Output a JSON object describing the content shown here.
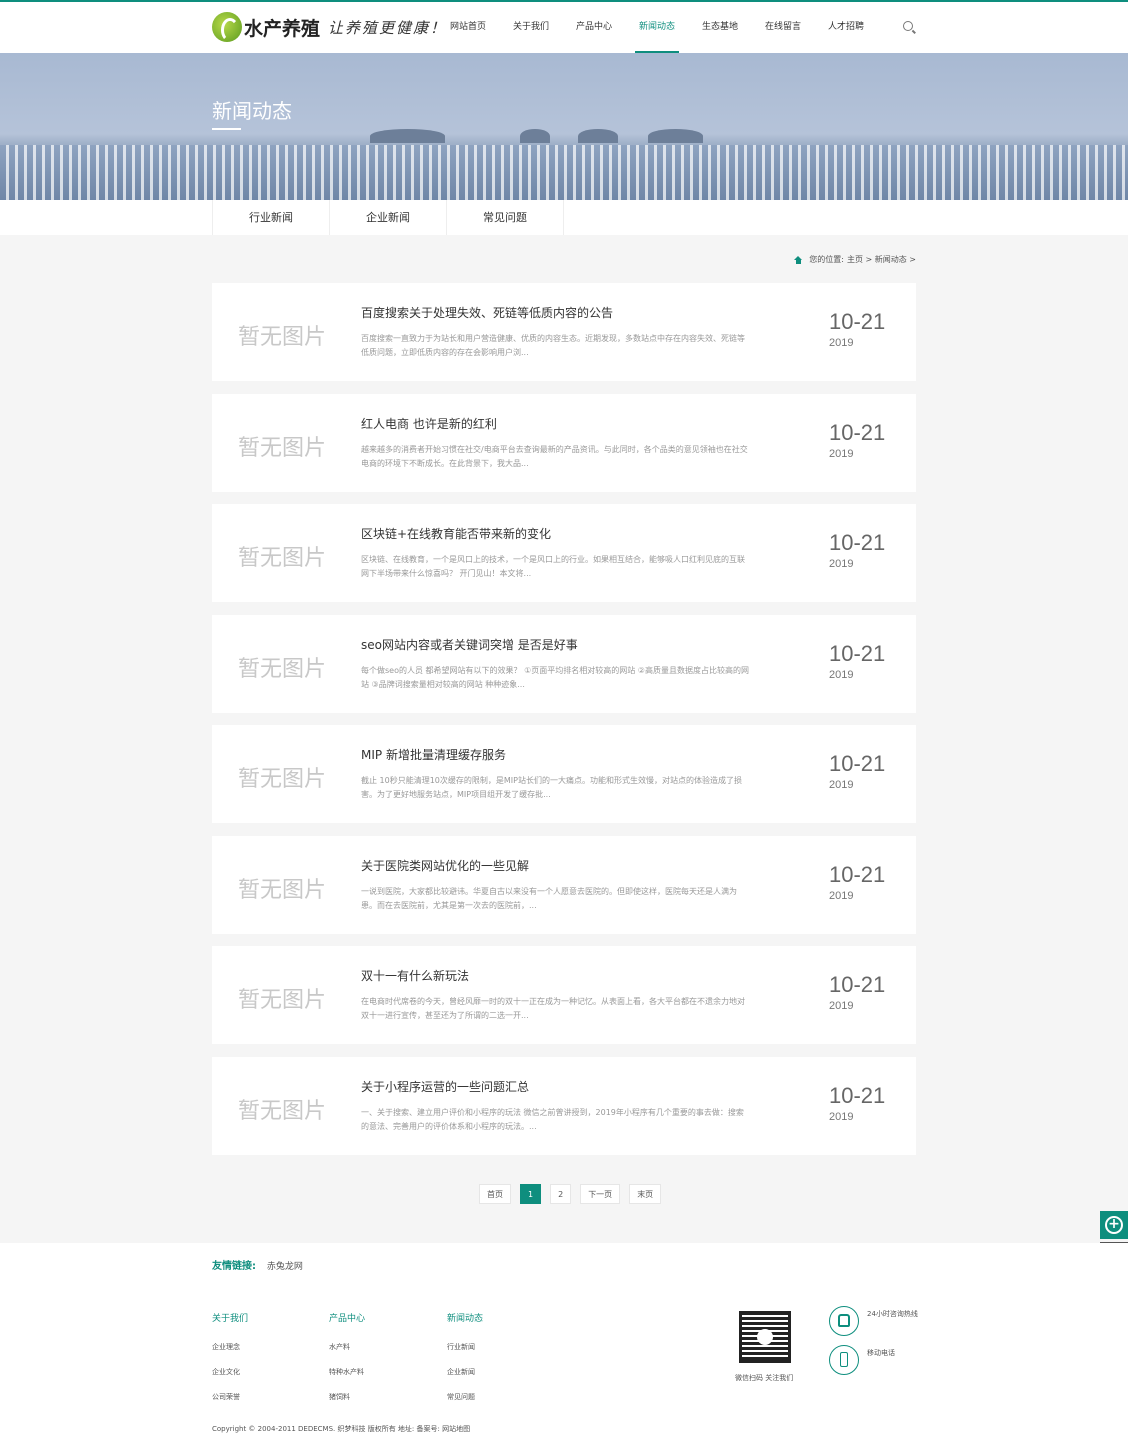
{
  "header": {
    "logo_name": "水产养殖",
    "logo_slogan": "让养殖更健康！",
    "nav": [
      "网站首页",
      "关于我们",
      "产品中心",
      "新闻动态",
      "生态基地",
      "在线留言",
      "人才招聘"
    ]
  },
  "banner": {
    "title": "新闻动态"
  },
  "subnav": [
    "行业新闻",
    "企业新闻",
    "常见问题"
  ],
  "breadcrumb": {
    "prefix": "您的位置:",
    "path": "主页 > 新闻动态 >"
  },
  "articles": [
    {
      "thumb": "暂无图片",
      "title": "百度搜索关于处理失效、死链等低质内容的公告",
      "desc": "百度搜索一直致力于为站长和用户营造健康、优质的内容生态。近期发现，多数站点中存在内容失效、死链等低质问题，立即低质内容的存在会影响用户浏...",
      "day": "10-21",
      "year": "2019"
    },
    {
      "thumb": "暂无图片",
      "title": "红人电商 也许是新的红利",
      "desc": "越来越多的消费者开始习惯在社交/电商平台去查询最新的产品资讯。与此同时，各个品类的意见领袖也在社交电商的环境下不断成长。在此背景下，我大品...",
      "day": "10-21",
      "year": "2019"
    },
    {
      "thumb": "暂无图片",
      "title": "区块链+在线教育能否带来新的变化",
      "desc": "区块链、在线教育，一个是风口上的技术，一个是风口上的行业。如果相互结合，能够吸人口红利见底的互联网下半场带来什么惊喜吗？ 开门见山！本文将...",
      "day": "10-21",
      "year": "2019"
    },
    {
      "thumb": "暂无图片",
      "title": "seo网站内容或者关键词突增 是否是好事",
      "desc": "每个做seo的人员 都希望网站有以下的效果？ ①页面平均排名相对较高的网站 ②高质量且数据度占比较高的网站 ③品牌词搜索量相对较高的网站 种种迹象...",
      "day": "10-21",
      "year": "2019"
    },
    {
      "thumb": "暂无图片",
      "title": "MIP 新增批量清理缓存服务",
      "desc": "截止 10秒只能清理10次缓存的限制，是MIP站长们的一大痛点。功能和形式生效慢，对站点的体验造成了损害。为了更好地服务站点，MIP项目组开发了缓存批...",
      "day": "10-21",
      "year": "2019"
    },
    {
      "thumb": "暂无图片",
      "title": "关于医院类网站优化的一些见解",
      "desc": "一说到医院，大家都比较避讳。华夏自古以来没有一个人愿意去医院的。但即使这样，医院每天还是人满为患。而在去医院前，尤其是第一次去的医院前，...",
      "day": "10-21",
      "year": "2019"
    },
    {
      "thumb": "暂无图片",
      "title": "双十一有什么新玩法",
      "desc": "在电商时代席卷的今天，曾经风靡一时的双十一正在成为一种记忆。从表面上看，各大平台都在不遗余力地对双十一进行宣传，甚至还为了所谓的二选一开...",
      "day": "10-21",
      "year": "2019"
    },
    {
      "thumb": "暂无图片",
      "title": "关于小程序运营的一些问题汇总",
      "desc": "一、关于搜索、建立用户评价和小程序的玩法 微信之前曾讲授到，2019年小程序有几个重要的事去做：搜索的意法、完善用户的评价体系和小程序的玩法。...",
      "day": "10-21",
      "year": "2019"
    }
  ],
  "pager": {
    "first": "首页",
    "pages": [
      "1",
      "2"
    ],
    "next": "下一页",
    "last": "末页"
  },
  "footer": {
    "links_label": "友情链接:",
    "links": [
      "赤兔龙网"
    ],
    "cols": [
      {
        "title": "关于我们",
        "items": [
          "企业理念",
          "企业文化",
          "公司荣誉"
        ]
      },
      {
        "title": "产品中心",
        "items": [
          "水产料",
          "特种水产料",
          "猪饲料"
        ]
      },
      {
        "title": "新闻动态",
        "items": [
          "行业新闻",
          "企业新闻",
          "常见问题"
        ]
      }
    ],
    "qr_label": "微信扫码 关注我们",
    "hotline_label": "24小时咨询热线",
    "mobile_label": "移动电话",
    "copyright": "Copyright © 2004-2011 DEDECMS. 织梦科技 版权所有   地址:    备案号:    网站地图"
  }
}
